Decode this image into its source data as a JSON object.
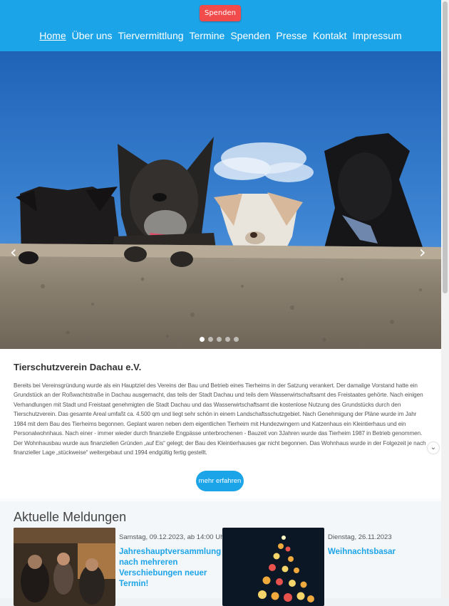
{
  "header": {
    "donate_label": "Spenden",
    "nav": [
      {
        "label": "Home",
        "active": true
      },
      {
        "label": "Über uns"
      },
      {
        "label": "Tiervermittlung"
      },
      {
        "label": "Termine"
      },
      {
        "label": "Spenden"
      },
      {
        "label": "Presse"
      },
      {
        "label": "Kontakt"
      },
      {
        "label": "Impressum"
      }
    ]
  },
  "slider": {
    "prev_icon": "‹",
    "next_icon": "›",
    "slide_count": 5,
    "active_slide": 1
  },
  "about": {
    "title": "Tierschutzverein Dachau e.V.",
    "text": "Bereits bei Vereinsgründung wurde als ein Hauptziel des Vereins der Bau und Betrieb eines Tierheims in der Satzung verankert. Der damalige Vorstand hatte ein Grundstück an der Roßwachtstraße in Dachau ausgemacht, das teils der Stadt Dachau und teils dem Wasserwirtschaftsamt des Freistaates gehörte. Nach einigen Verhandlungen mit Stadt und Freistaat genehmigten die Stadt Dachau und das Wasserwirtschaftsamt die kostenlose Nutzung des Grundstücks durch den Tierschutzverein. Das gesamte Areal umfaßt ca. 4.500 qm und liegt sehr schön in einem Landschaftsschutzgebiet. Nach Genehmigung der Pläne wurde im Jahr 1984 mit dem Bau des Tierheims begonnen. Geplant waren neben dem eigentlichen Tierheim mit Hundezwingern und Katzenhaus ein Kleintierhaus und ein Personalwohnhaus. Nach einer - immer wieder durch finanzielle Engpässe unterbrochenen - Bauzeit von 3Jahren wurde das Tierheim 1987 in Betrieb genommen. Der Wohnhausbau wurde aus finanziellen Gründen „auf Eis“ gelegt; der Bau des Kleintierhauses gar nicht begonnen. Das Wohnhaus wurde in der Folgezeit je nach finanzieller Lage „stückweise“ weitergebaut und 1994 endgültig fertig gestellt.",
    "more_label": "mehr erfahren"
  },
  "news": {
    "title": "Aktuelle Meldungen",
    "items": [
      {
        "date": "Samstag, 09.12.2023, ab 14:00 Uhr",
        "title": "Jahreshauptversammlung nach mehreren Verschiebungen neuer Termin!"
      },
      {
        "date": "Dienstag, 26.11.2023",
        "title": "Weihnachtsbasar"
      }
    ]
  },
  "scroll_down_icon": "⌄",
  "colors": {
    "header": "#1ca4e8",
    "donate": "#f24b4b",
    "accent": "#1ca4e8"
  }
}
